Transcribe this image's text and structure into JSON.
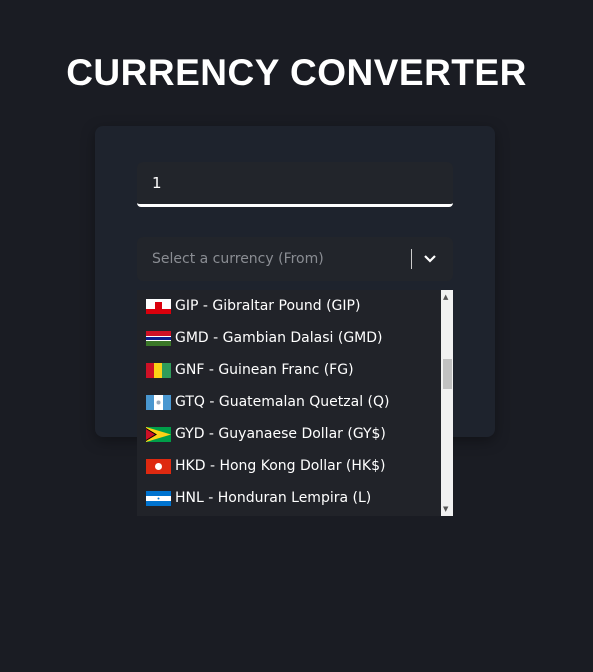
{
  "title": "CURRENCY CONVERTER",
  "amount": {
    "value": "1"
  },
  "from_select": {
    "placeholder": "Select a currency (From)"
  },
  "options": [
    {
      "label": "GIP - Gibraltar Pound (GIP)",
      "flag": "gibraltar"
    },
    {
      "label": "GMD - Gambian Dalasi (GMD)",
      "flag": "gambia"
    },
    {
      "label": "GNF - Guinean Franc (FG)",
      "flag": "guinea"
    },
    {
      "label": "GTQ - Guatemalan Quetzal (Q)",
      "flag": "guatemala"
    },
    {
      "label": "GYD - Guyanaese Dollar (GY$)",
      "flag": "guyana"
    },
    {
      "label": "HKD - Hong Kong Dollar (HK$)",
      "flag": "hong-kong"
    },
    {
      "label": "HNL - Honduran Lempira (L)",
      "flag": "honduras"
    }
  ]
}
